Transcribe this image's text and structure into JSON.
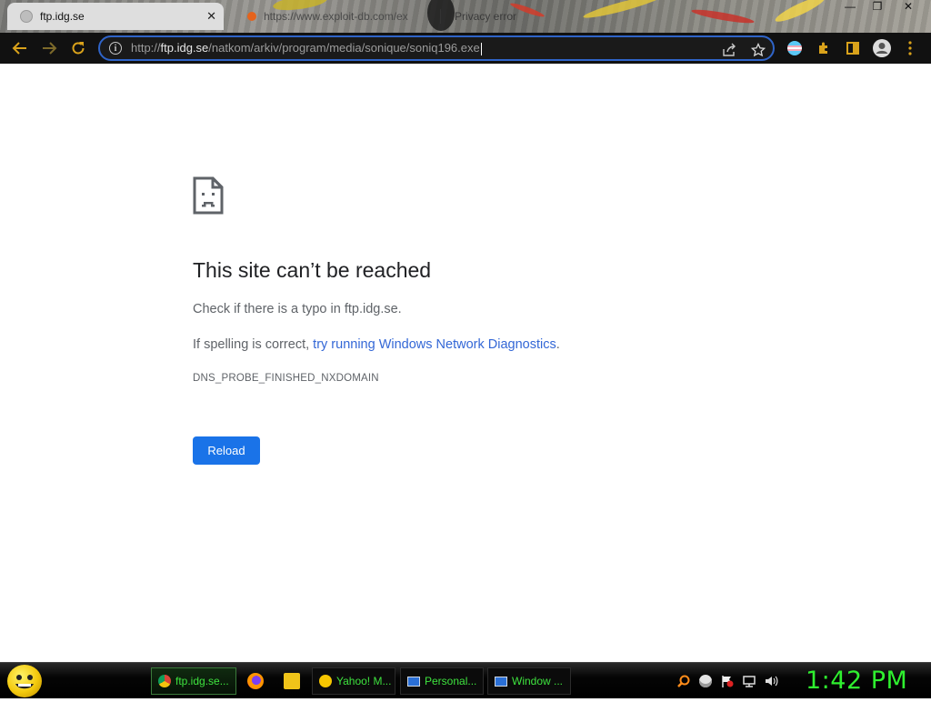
{
  "tabs": [
    {
      "label": "ftp.idg.se",
      "close": "✕"
    },
    {
      "label": "https://www.exploit-db.com/ex"
    },
    {
      "label": "Privacy error"
    }
  ],
  "window_controls": {
    "minimize": "—",
    "restore": "❐",
    "close": "✕"
  },
  "address_bar": {
    "scheme": "http://",
    "host": "ftp.idg.se",
    "path": "/natkom/arkiv/program/media/sonique/soniq196.exe"
  },
  "error_page": {
    "title": "This site can’t be reached",
    "check_text": "Check if there is a typo in ftp.idg.se.",
    "spelling_prefix": "If spelling is correct, ",
    "diagnostics_link": "try running Windows Network Diagnostics",
    "spelling_suffix": ".",
    "error_code": "DNS_PROBE_FINISHED_NXDOMAIN",
    "reload_label": "Reload"
  },
  "taskbar": {
    "items": [
      {
        "label": "ftp.idg.se..."
      },
      {
        "label": "Yahoo! M..."
      },
      {
        "label": "Personal..."
      },
      {
        "label": "Window ..."
      }
    ],
    "clock": "1:42 PM"
  },
  "colors": {
    "accent": "#1a73e8",
    "omnibox_border": "#2f64c8",
    "taskbar_text": "#3ee33e",
    "clock": "#2ff02f"
  }
}
